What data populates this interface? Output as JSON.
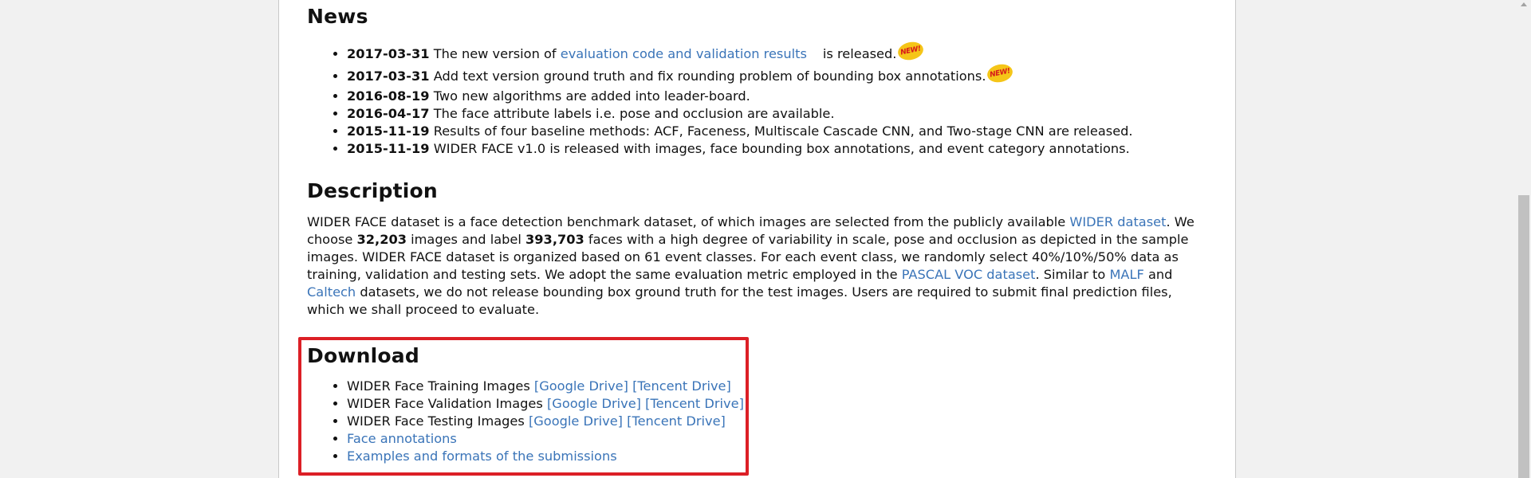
{
  "news": {
    "title": "News",
    "badge_text": "NEW!",
    "items": [
      {
        "date": "2017-03-31",
        "pre": "The new version of ",
        "link": "evaluation code and validation results",
        "post": "is released."
      },
      {
        "date": "2017-03-31",
        "text": "Add text version ground truth and fix rounding problem of bounding box annotations."
      },
      {
        "date": "2016-08-19",
        "text": "Two new algorithms are added into leader-board."
      },
      {
        "date": "2016-04-17",
        "text": "The face attribute labels i.e. pose and occlusion are available."
      },
      {
        "date": "2015-11-19",
        "text": "Results of four baseline methods: ACF, Faceness, Multiscale Cascade CNN, and Two-stage CNN are released."
      },
      {
        "date": "2015-11-19",
        "text": "WIDER FACE v1.0 is released with images, face bounding box annotations, and event category annotations."
      }
    ]
  },
  "description": {
    "title": "Description",
    "t1": "WIDER FACE dataset is a face detection benchmark dataset, of which images are selected from the publicly available ",
    "link_wider": "WIDER dataset",
    "t2": ". We choose ",
    "num_images": "32,203",
    "t3": " images and label ",
    "num_faces": "393,703",
    "t4": " faces with a high degree of variability in scale, pose and occlusion as depicted in the sample images. WIDER FACE dataset is organized based on 61 event classes. For each event class, we randomly select 40%/10%/50% data as training, validation and testing sets. We adopt the same evaluation metric employed in the ",
    "link_pascal": "PASCAL VOC dataset",
    "t5": ". Similar to ",
    "link_malf": "MALF",
    "t6": " and ",
    "link_caltech": "Caltech",
    "t7": " datasets, we do not release bounding box ground truth for the test images. Users are required to submit final prediction files, which we shall proceed to evaluate."
  },
  "download": {
    "title": "Download",
    "training": {
      "label": "WIDER Face Training Images ",
      "gdrive": "[Google Drive]",
      "tencent": "[Tencent Drive]"
    },
    "validation": {
      "label": "WIDER Face Validation Images ",
      "gdrive": "[Google Drive]",
      "tencent": "[Tencent Drive]"
    },
    "testing": {
      "label": "WIDER Face Testing Images ",
      "gdrive": "[Google Drive]",
      "tencent": "[Tencent Drive]"
    },
    "annotations": "Face annotations",
    "examples": "Examples and formats of the submissions"
  },
  "colors": {
    "link": "#3a74b8",
    "highlight_box": "#dc1f26",
    "badge_bg": "#f5c518",
    "badge_text": "#d71a1a"
  }
}
